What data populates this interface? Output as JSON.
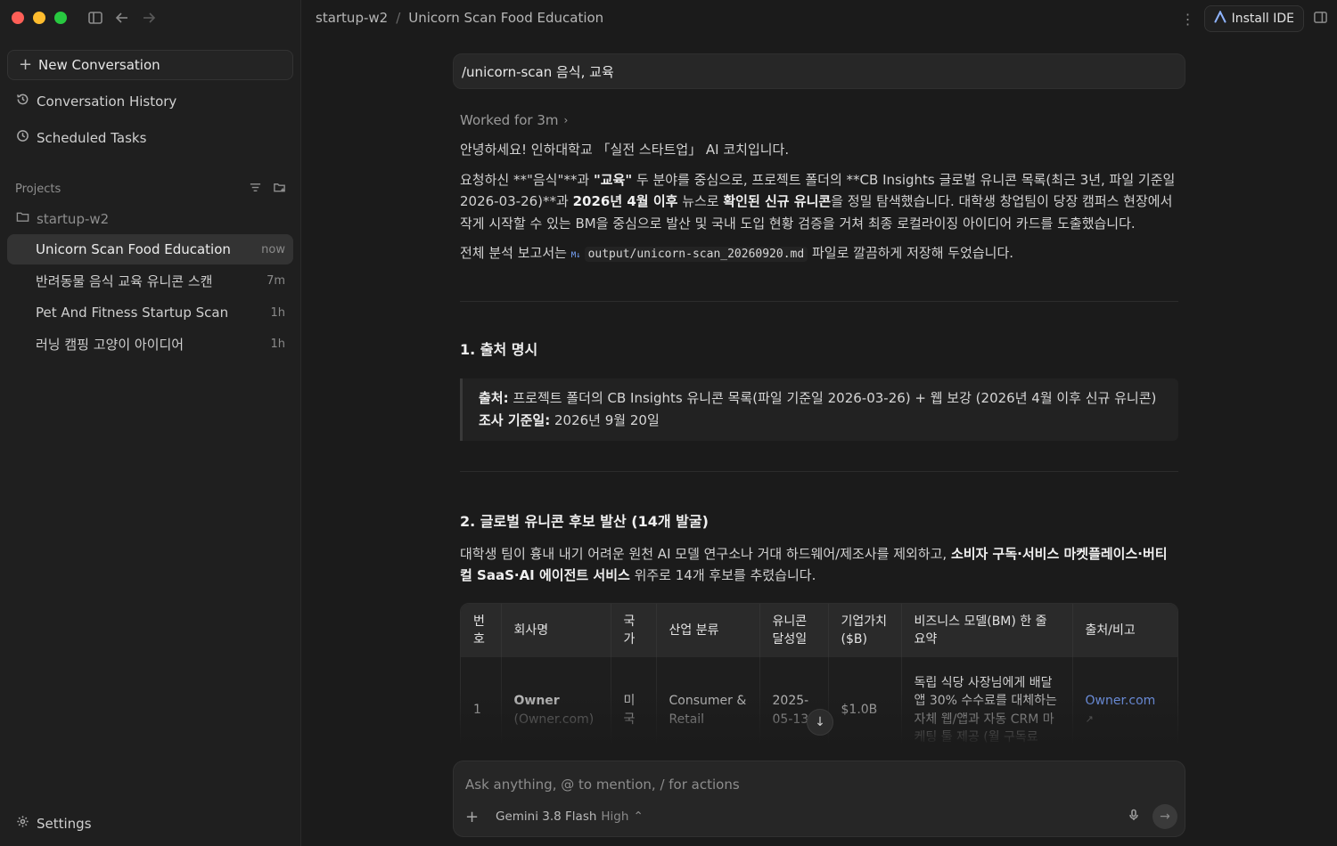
{
  "sidebar": {
    "new_conversation": "New Conversation",
    "history": "Conversation History",
    "scheduled": "Scheduled Tasks",
    "projects_label": "Projects",
    "folder": "startup-w2",
    "conversations": [
      {
        "title": "Unicorn Scan Food Education",
        "time": "now"
      },
      {
        "title": "반려동물 음식 교육 유니콘 스캔",
        "time": "7m"
      },
      {
        "title": "Pet And Fitness Startup Scan",
        "time": "1h"
      },
      {
        "title": "러닝 캠핑 고양이 아이디어",
        "time": "1h"
      }
    ],
    "settings": "Settings"
  },
  "header": {
    "crumb_project": "startup-w2",
    "crumb_sep": "/",
    "crumb_title": "Unicorn Scan Food Education",
    "install_ide": "Install IDE"
  },
  "chat": {
    "user_prompt": "/unicorn-scan 음식, 교육",
    "worked_for": "Worked for 3m",
    "greeting": "안녕하세요! 인하대학교 「실전 스타트업」 AI 코치입니다.",
    "p1_a": "요청하신 **\"음식\"**과 ",
    "p1_b": "\"교육\"",
    "p1_c": " 두 분야를 중심으로, 프로젝트 폴더의 **CB Insights 글로벌 유니콘 목록(최근 3년, 파일 기준일 2026-03-26)**과 ",
    "p1_d": "2026년 4월 이후",
    "p1_e": " 뉴스로 ",
    "p1_f": "확인된 신규 유니콘",
    "p1_g": "을 정밀 탐색했습니다. 대학생 창업팀이 당장 캠퍼스 현장에서 작게 시작할 수 있는 BM을 중심으로 발산 및 국내 도입 현황 검증을 거쳐 최종 로컬라이징 아이디어 카드를 도출했습니다.",
    "p2_a": "전체 분석 보고서는 ",
    "md_badge": "M↓",
    "p2_file": "output/unicorn-scan_20260920.md",
    "p2_b": " 파일로 깔끔하게 저장해 두었습니다.",
    "s1_title": "1. 출처 명시",
    "s1_src_label": "출처:",
    "s1_src_text": " 프로젝트 폴더의 CB Insights 유니콘 목록(파일 기준일 2026-03-26) + 웹 보강 (2026년 4월 이후 신규 유니콘)",
    "s1_date_label": "조사 기준일:",
    "s1_date_text": " 2026년 9월 20일",
    "s2_title": "2. 글로벌 유니콘 후보 발산 (14개 발굴)",
    "s2_a": "대학생 팀이 흉내 내기 어려운 원천 AI 모델 연구소나 거대 하드웨어/제조사를 제외하고, ",
    "s2_b": "소비자 구독·서비스 마켓플레이스·버티컬 SaaS·AI 에이전트 서비스",
    "s2_c": " 위주로 14개 후보를 추렸습니다.",
    "table": {
      "headers": [
        "번호",
        "회사명",
        "국가",
        "산업 분류",
        "유니콘 달성일",
        "기업가치 ($B)",
        "비즈니스 모델(BM) 한 줄 요약",
        "출처/비고"
      ],
      "row": {
        "no": "1",
        "name": "Owner",
        "name_sub": "(Owner.com)",
        "country": "미국",
        "industry": "Consumer & Retail",
        "date": "2025-05-13",
        "valuation": "$1.0B",
        "bm": "독립 식당 사장님에게 배달 앱 30% 수수료를 대체하는 자체 웹/앱과 자동 CRM 마케팅 툴 제공 (월 구독료",
        "source": "Owner.com"
      }
    }
  },
  "composer": {
    "placeholder": "Ask anything, @ to mention, / for actions",
    "model": "Gemini 3.8 Flash",
    "mode": "High"
  }
}
